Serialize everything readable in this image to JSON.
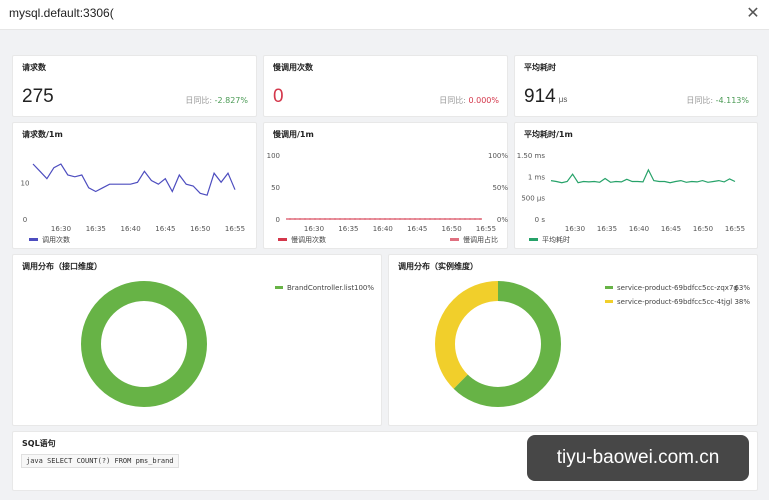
{
  "window": {
    "title": "mysql.default:3306(",
    "close_label": "✕"
  },
  "stats": [
    {
      "title": "请求数",
      "value": "275",
      "unit": "",
      "ratio_label": "日同比:",
      "ratio_value": "-2.827%",
      "ratio_color": "green"
    },
    {
      "title": "慢调用次数",
      "value": "0",
      "unit": "",
      "ratio_label": "日同比:",
      "ratio_value": "0.000%",
      "ratio_color": "red"
    },
    {
      "title": "平均耗时",
      "value": "914",
      "unit": "μs",
      "ratio_label": "日同比:",
      "ratio_value": "-4.113%",
      "ratio_color": "green"
    }
  ],
  "chart_data": [
    {
      "type": "line",
      "title": "请求数/1m",
      "x": [
        "16:30",
        "16:35",
        "16:40",
        "16:45",
        "16:50",
        "16:55"
      ],
      "yticks": [
        "10",
        "0"
      ],
      "ylim": [
        0,
        18
      ],
      "series": [
        {
          "name": "调用次数",
          "color": "#4d4dbf",
          "values": [
            15,
            13,
            11,
            14,
            15,
            12,
            11.5,
            12,
            8.5,
            7.5,
            8.5,
            9.5,
            9.5,
            9.5,
            9.5,
            10,
            13,
            10.5,
            9.5,
            11,
            7.5,
            12,
            9.5,
            9,
            7,
            6.5,
            12.5,
            10,
            12.5,
            8
          ]
        }
      ]
    },
    {
      "type": "line",
      "title": "慢调用/1m",
      "x": [
        "16:30",
        "16:35",
        "16:40",
        "16:45",
        "16:50",
        "16:55"
      ],
      "yticks": [
        "100",
        "50",
        "0"
      ],
      "y2ticks": [
        "100%",
        "50%",
        "0%"
      ],
      "ylim": [
        0,
        100
      ],
      "series": [
        {
          "name": "慢调用次数",
          "color": "#d4374b",
          "values": [
            0,
            0,
            0,
            0,
            0,
            0,
            0,
            0,
            0,
            0,
            0,
            0,
            0,
            0,
            0,
            0,
            0,
            0,
            0,
            0,
            0,
            0,
            0,
            0,
            0,
            0,
            0,
            0,
            0,
            0
          ]
        },
        {
          "name": "慢调用占比",
          "color": "#e07080",
          "values": [
            0,
            0,
            0,
            0,
            0,
            0,
            0,
            0,
            0,
            0,
            0,
            0,
            0,
            0,
            0,
            0,
            0,
            0,
            0,
            0,
            0,
            0,
            0,
            0,
            0,
            0,
            0,
            0,
            0,
            0
          ]
        }
      ]
    },
    {
      "type": "line",
      "title": "平均耗时/1m",
      "x": [
        "16:30",
        "16:35",
        "16:40",
        "16:45",
        "16:50",
        "16:55"
      ],
      "yticks": [
        "1.50 ms",
        "1 ms",
        "500 μs",
        "0 s"
      ],
      "ylim": [
        0,
        1500
      ],
      "series": [
        {
          "name": "平均耗时",
          "color": "#26a269",
          "values": [
            900,
            880,
            850,
            880,
            1050,
            850,
            880,
            870,
            880,
            860,
            950,
            860,
            880,
            870,
            930,
            880,
            880,
            870,
            1150,
            900,
            880,
            880,
            850,
            880,
            900,
            860,
            880,
            870,
            900,
            860,
            880,
            900,
            870,
            940,
            880
          ]
        }
      ]
    },
    {
      "type": "pie",
      "title": "调用分布（接口维度）",
      "slices": [
        {
          "label": "BrandController.list",
          "value": 100,
          "value_label": "100%",
          "color": "#67b346"
        }
      ]
    },
    {
      "type": "pie",
      "title": "调用分布（实例维度）",
      "slices": [
        {
          "label": "service-product-69bdfcc5cc-zqx7g",
          "value": 63,
          "value_label": "63%",
          "color": "#67b346"
        },
        {
          "label": "service-product-69bdfcc5cc-4tjgl",
          "value": 38,
          "value_label": "38%",
          "color": "#f1cf2b"
        }
      ]
    }
  ],
  "sql": {
    "title": "SQL语句",
    "text": "java SELECT COUNT(?) FROM pms_brand"
  },
  "watermark": "tiyu-baowei.com.cn"
}
